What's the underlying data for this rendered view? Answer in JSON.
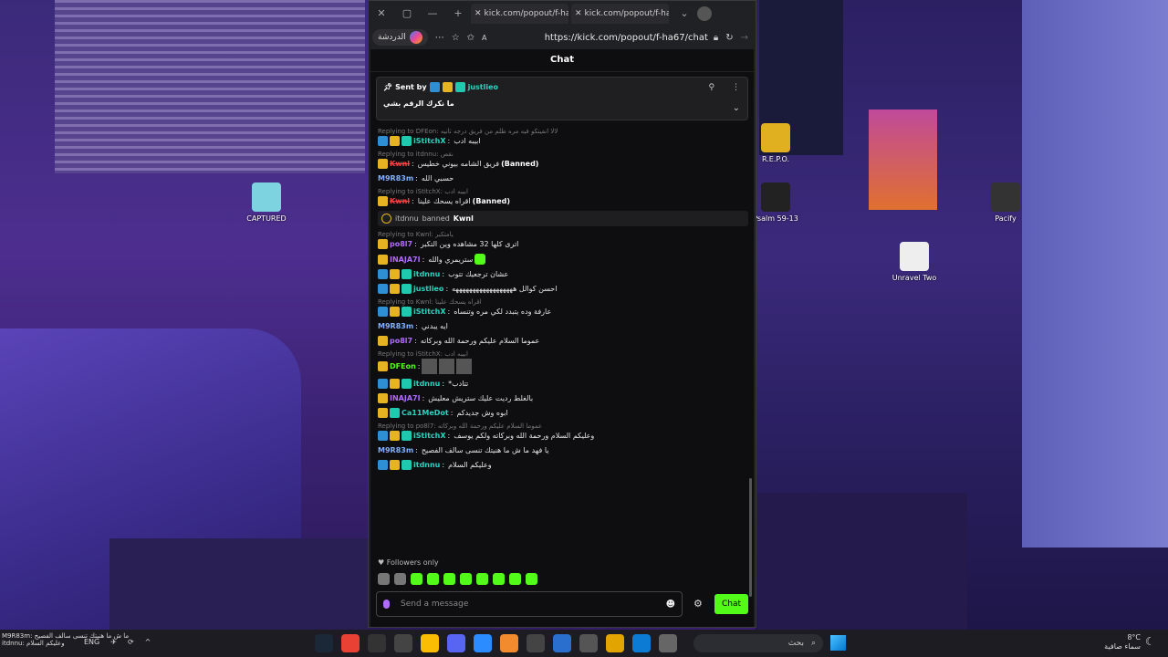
{
  "desktop": {
    "icons": [
      {
        "label": "CAPTURED"
      },
      {
        "label": "R.E.P.O."
      },
      {
        "label": "Psalm 59-13"
      },
      {
        "label": "Pacify"
      },
      {
        "label": "Unravel Two"
      }
    ]
  },
  "browser": {
    "tabs": [
      {
        "label": "kick.com/popout/f-ha"
      },
      {
        "label": "kick.com/popout/f-ha"
      }
    ],
    "copilot_label": "الدردشة",
    "url": "https://kick.com/popout/f-ha67/chat"
  },
  "chat": {
    "title": "Chat",
    "pinned": {
      "sent_by_label": "Sent by",
      "username": "justlieo",
      "message": "ما نكرك الرقم بشي"
    },
    "messages": [
      {
        "reply": "Replying to DFEon: لالا انفينكو فيه مره ظلم من فريق درجه ثانيه",
        "user": "iStitchX",
        "text": "ابيبه ادب",
        "color": "u-teal",
        "badges": [
          "b-blue",
          "b-gold",
          "b-teal"
        ]
      },
      {
        "reply": "Replying to itdnnu: نقص",
        "user": "Kwnl",
        "text": "فريق الشامه بيوني خطيس",
        "banned": "(Banned)",
        "color": "u-red",
        "badges": [
          "b-gold"
        ]
      },
      {
        "user": "M9R83m",
        "text": "حسبي الله",
        "color": "u-blue",
        "badges": []
      },
      {
        "reply": "Replying to iStitchX: ابيبه ادب",
        "user": "Kwnl",
        "text": "اقراه يسحك علينا",
        "banned": "(Banned)",
        "color": "u-red",
        "badges": [
          "b-gold"
        ]
      }
    ],
    "mod_event": {
      "actor": "itdnnu",
      "verb": "banned",
      "target": "Kwnl"
    },
    "messages2": [
      {
        "reply": "Replying to Kwnl: يامتكبر",
        "user": "po8l7",
        "text": "اترى كلها 32 مشاهده وين التكبر",
        "color": "u-purple",
        "badges": [
          "b-gold"
        ]
      },
      {
        "user": "INAJA7I",
        "text": "ستريمري والله",
        "color": "u-purple",
        "badges": [
          "b-gold"
        ],
        "emote": true
      },
      {
        "user": "itdnnu",
        "text": "عشان ترجعيك تتوب",
        "color": "u-teal",
        "badges": [
          "b-blue",
          "b-gold",
          "b-teal"
        ]
      },
      {
        "user": "justlieo",
        "text": "احسن كوالل ههههههههههههههههههه",
        "color": "u-teal",
        "badges": [
          "b-blue",
          "b-gold",
          "b-teal"
        ]
      },
      {
        "reply": "Replying to Kwnl: اقراه يسحك علينا",
        "user": "iStitchX",
        "text": "عارفة وده يتبدد لكي مره وتنساه",
        "color": "u-teal",
        "badges": [
          "b-blue",
          "b-gold",
          "b-teal"
        ]
      },
      {
        "user": "M9R83m",
        "text": "ايه يبدني",
        "color": "u-blue",
        "badges": []
      },
      {
        "user": "po8l7",
        "text": "عموما السلام عليكم ورحمة الله وبركاته",
        "color": "u-purple",
        "badges": [
          "b-gold"
        ]
      },
      {
        "reply": "Replying to iStitchX: ابيبه ادب",
        "user": "DFEon",
        "text": "",
        "color": "u-green",
        "badges": [
          "b-gold"
        ],
        "gifs": true
      },
      {
        "user": "itdnnu",
        "text": "*تتادب",
        "color": "u-teal",
        "badges": [
          "b-blue",
          "b-gold",
          "b-teal"
        ]
      },
      {
        "user": "INAJA7I",
        "text": "بالغلط رديت عليك ستريش معليش",
        "color": "u-purple",
        "badges": [
          "b-gold"
        ]
      },
      {
        "user": "Ca11MeDot",
        "text": "ابوه وش جديدكم",
        "color": "u-teal",
        "badges": [
          "b-gold",
          "b-teal"
        ]
      },
      {
        "reply": "Replying to po8l7: عموما السلام عليكم ورحمة الله وبركاته",
        "user": "iStitchX",
        "text": "وعليكم السلام ورحمة الله وبركاته ولكم يوسف",
        "color": "u-teal",
        "badges": [
          "b-blue",
          "b-gold",
          "b-teal"
        ]
      },
      {
        "user": "M9R83m",
        "text": "يا فهد ما ش ما هنيتك تنسى سالف الفصيح",
        "color": "u-blue",
        "badges": []
      },
      {
        "user": "itdnnu",
        "text": "وعليكم السلام",
        "color": "u-teal",
        "badges": [
          "b-blue",
          "b-gold",
          "b-teal"
        ]
      }
    ],
    "followers_only": "Followers only",
    "input_placeholder": "Send a message",
    "chat_button": "Chat"
  },
  "taskbar": {
    "notif_line1": "M9R83m: يا فهد ما ش ما هنيتك تنسى سالف الفصيح",
    "notif_line2": "itdnnu: وعليكم السلام",
    "lang": "ENG",
    "search_placeholder": "بحث",
    "weather_temp": "8°C",
    "weather_desc": "سماء صافية"
  }
}
